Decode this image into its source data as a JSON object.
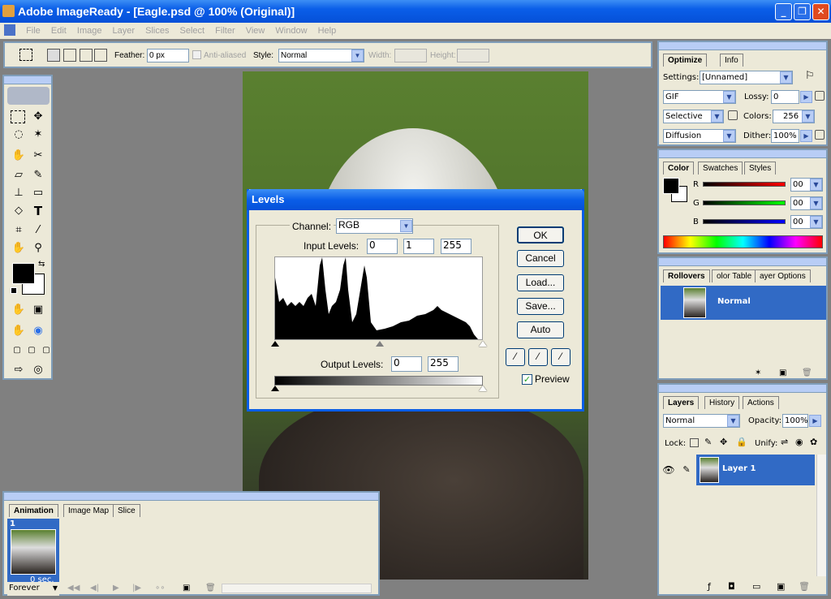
{
  "window": {
    "title": "Adobe ImageReady - [Eagle.psd @ 100% (Original)]",
    "min": "_",
    "max": "❐",
    "close": "✕"
  },
  "menu": [
    "File",
    "Edit",
    "Image",
    "Layer",
    "Slices",
    "Select",
    "Filter",
    "View",
    "Window",
    "Help"
  ],
  "options": {
    "feather_label": "Feather:",
    "feather_value": "0 px",
    "antialias_label": "Anti-aliased",
    "style_label": "Style:",
    "style_value": "Normal",
    "width_label": "Width:",
    "height_label": "Height:"
  },
  "levels": {
    "title": "Levels",
    "channel_label": "Channel:",
    "channel_value": "RGB",
    "input_label": "Input Levels:",
    "input_black": "0",
    "input_gamma": "1",
    "input_white": "255",
    "output_label": "Output Levels:",
    "output_black": "0",
    "output_white": "255",
    "ok": "OK",
    "cancel": "Cancel",
    "load": "Load...",
    "save": "Save...",
    "auto": "Auto",
    "preview_label": "Preview",
    "preview_checked": true
  },
  "optimize": {
    "tabs": [
      "Optimize",
      "Info"
    ],
    "settings_label": "Settings:",
    "settings_value": "[Unnamed]",
    "format_value": "GIF",
    "lossy_label": "Lossy:",
    "lossy_value": "0",
    "reduction_value": "Selective",
    "colors_label": "Colors:",
    "colors_value": "256",
    "dither_method": "Diffusion",
    "dither_label": "Dither:",
    "dither_value": "100%"
  },
  "color": {
    "tabs": [
      "Color",
      "Swatches",
      "Styles"
    ],
    "r_label": "R",
    "g_label": "G",
    "b_label": "B",
    "r_value": "00",
    "g_value": "00",
    "b_value": "00"
  },
  "rollovers": {
    "tabs": [
      "Rollovers",
      "olor Table",
      "ayer Options"
    ],
    "state": "Normal"
  },
  "layers": {
    "tabs": [
      "Layers",
      "History",
      "Actions"
    ],
    "blend": "Normal",
    "opacity_label": "Opacity:",
    "opacity_value": "100%",
    "lock_label": "Lock:",
    "unify_label": "Unify:",
    "layer_name": "Layer 1"
  },
  "animation": {
    "tabs": [
      "Animation",
      "Image Map",
      "Slice"
    ],
    "frame_number": "1",
    "frame_delay": "0 sec.",
    "loop": "Forever"
  },
  "colors": {
    "accent": "#316ac5",
    "panel": "#ece9d8",
    "titlebar": "#0a5ee8"
  }
}
